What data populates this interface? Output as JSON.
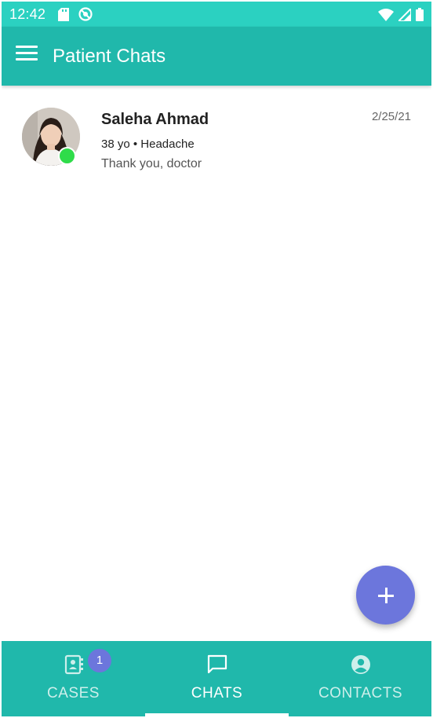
{
  "status_bar": {
    "time": "12:42"
  },
  "app_bar": {
    "title": "Patient Chats"
  },
  "chats": [
    {
      "name": "Saleha Ahmad",
      "meta": "38 yo • Headache",
      "preview": "Thank you, doctor",
      "date": "2/25/21",
      "online": true
    }
  ],
  "fab": {
    "icon": "plus-icon"
  },
  "bottom_nav": {
    "items": [
      {
        "label": "CASES",
        "icon": "contacts-book-icon",
        "badge": "1"
      },
      {
        "label": "CHATS",
        "icon": "chat-bubble-icon",
        "active": true
      },
      {
        "label": "CONTACTS",
        "icon": "account-circle-icon"
      }
    ]
  },
  "colors": {
    "accent": "#20b8ab",
    "status_bar": "#2bd1c1",
    "fab": "#6c76dc",
    "online": "#2fdc4a"
  }
}
